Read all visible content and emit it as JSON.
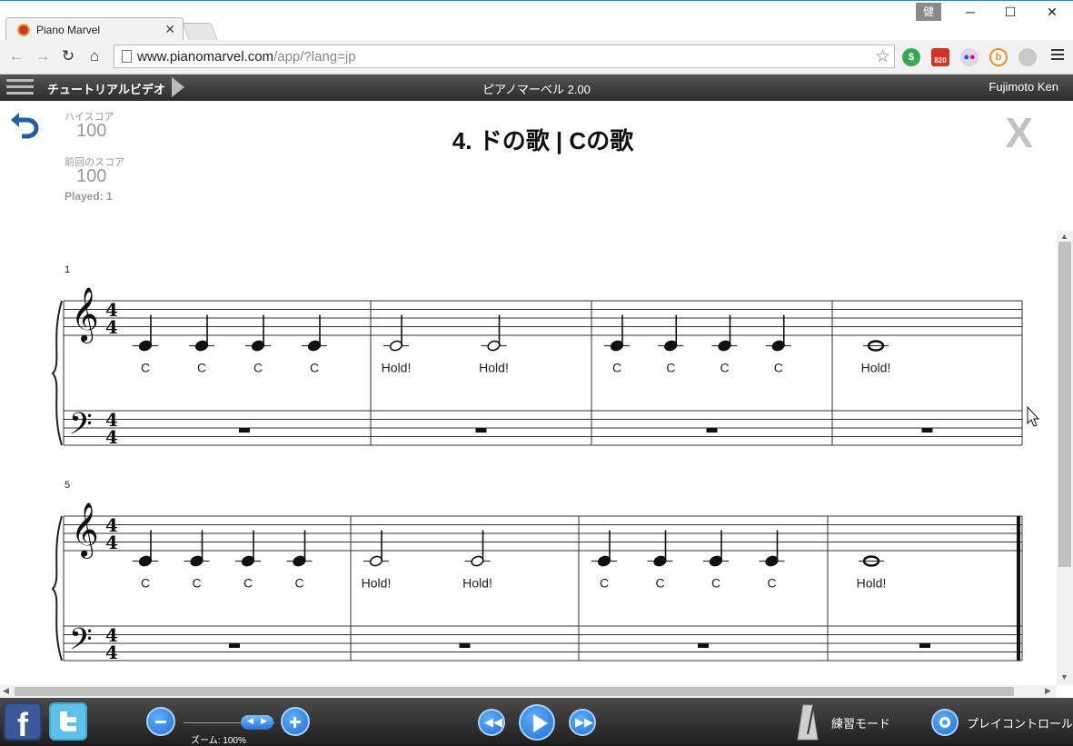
{
  "browser": {
    "tab_title": "Piano Marvel",
    "url_host": "www.pianomarvel.com",
    "url_rest": "/app/?lang=jp",
    "window_user_badge": "健",
    "extensions": [
      "evernote-icon",
      "gmail-icon",
      "flickr-icon",
      "b-icon",
      "globe-icon"
    ],
    "gmail_count": "820"
  },
  "app_header": {
    "tutorial_label": "チュートリアルビデオ",
    "title": "ピアノマーベル 2.00",
    "user": "Fujimoto Ken"
  },
  "scores": {
    "high_label": "ハイスコア",
    "high_value": "100",
    "last_label": "前回のスコア",
    "last_value": "100",
    "played": "Played: 1"
  },
  "song": {
    "title": "4. ドの歌 | Cの歌",
    "close_label": "X"
  },
  "music": {
    "time_signature": [
      "4",
      "4"
    ],
    "systems": [
      {
        "start_measure": "1",
        "final": false,
        "measures": [
          {
            "notes": [
              {
                "type": "quarter",
                "label": "C"
              },
              {
                "type": "quarter",
                "label": "C"
              },
              {
                "type": "quarter",
                "label": "C"
              },
              {
                "type": "quarter",
                "label": "C"
              }
            ]
          },
          {
            "notes": [
              {
                "type": "half",
                "label": "Hold!"
              },
              {
                "type": "half",
                "label": "Hold!"
              }
            ]
          },
          {
            "notes": [
              {
                "type": "quarter",
                "label": "C"
              },
              {
                "type": "quarter",
                "label": "C"
              },
              {
                "type": "quarter",
                "label": "C"
              },
              {
                "type": "quarter",
                "label": "C"
              }
            ]
          },
          {
            "notes": [
              {
                "type": "whole",
                "label": "Hold!"
              }
            ]
          }
        ]
      },
      {
        "start_measure": "5",
        "final": true,
        "measures": [
          {
            "notes": [
              {
                "type": "quarter",
                "label": "C"
              },
              {
                "type": "quarter",
                "label": "C"
              },
              {
                "type": "quarter",
                "label": "C"
              },
              {
                "type": "quarter",
                "label": "C"
              }
            ]
          },
          {
            "notes": [
              {
                "type": "half",
                "label": "Hold!"
              },
              {
                "type": "half",
                "label": "Hold!"
              }
            ]
          },
          {
            "notes": [
              {
                "type": "quarter",
                "label": "C"
              },
              {
                "type": "quarter",
                "label": "C"
              },
              {
                "type": "quarter",
                "label": "C"
              },
              {
                "type": "quarter",
                "label": "C"
              }
            ]
          },
          {
            "notes": [
              {
                "type": "whole",
                "label": "Hold!"
              }
            ]
          }
        ]
      }
    ]
  },
  "bottom_bar": {
    "zoom_label": "ズーム: 100%",
    "practice_mode": "練習モード",
    "play_controls": "プレイコントロール"
  },
  "colors": {
    "accent_blue": "#1f6fd0",
    "header_dark": "#2b2b2b",
    "score_gray": "#999999"
  }
}
